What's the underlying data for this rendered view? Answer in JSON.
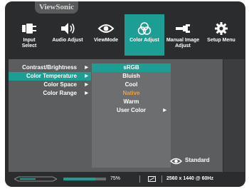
{
  "brand": "ViewSonic",
  "tabs": [
    {
      "label_1": "Input",
      "label_2": "Select",
      "icon": "input-select-icon",
      "active": false
    },
    {
      "label_1": "Audio Adjust",
      "label_2": "",
      "icon": "speaker-icon",
      "active": false
    },
    {
      "label_1": "ViewMode",
      "label_2": "",
      "icon": "eye-icon",
      "active": false
    },
    {
      "label_1": "Color Adjust",
      "label_2": "",
      "icon": "color-circles-icon",
      "active": true
    },
    {
      "label_1": "Manual Image",
      "label_2": "Adjust",
      "icon": "wrench-icon",
      "active": false
    },
    {
      "label_1": "Setup Menu",
      "label_2": "",
      "icon": "gear-icon",
      "active": false
    }
  ],
  "menu": {
    "items": [
      {
        "label": "Contrast/Brightness",
        "arrow": "▶"
      },
      {
        "label": "Color Temperature",
        "arrow": "▶"
      },
      {
        "label": "Color Space",
        "arrow": "▶"
      },
      {
        "label": "Color Range",
        "arrow": "▶"
      }
    ],
    "selected_index": 1
  },
  "submenu": {
    "items": [
      {
        "label": "sRGB"
      },
      {
        "label": "Bluish"
      },
      {
        "label": "Cool"
      },
      {
        "label": "Native"
      },
      {
        "label": "Warm"
      },
      {
        "label": "User Color",
        "arrow": "▶"
      }
    ],
    "selected_index": 0,
    "current_index": 3
  },
  "viewmode": {
    "label": "Standard",
    "icon": "eye-icon"
  },
  "status": {
    "progress_value": 75,
    "progress_label": "75%",
    "resolution": "2560 x 1440 @ 60Hz"
  },
  "colors": {
    "accent": "#1d9e94",
    "current": "#e8a33e"
  }
}
